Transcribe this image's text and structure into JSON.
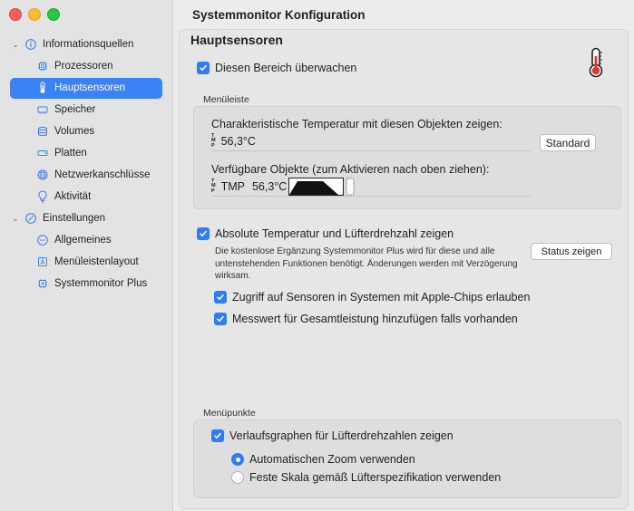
{
  "window": {
    "title": "Systemmonitor Konfiguration"
  },
  "sidebar": {
    "groups": [
      {
        "label": "Informationsquellen",
        "icon": "info-circle-icon",
        "items": [
          {
            "label": "Prozessoren",
            "icon": "cpu-chip-icon"
          },
          {
            "label": "Hauptsensoren",
            "icon": "thermometer-icon",
            "selected": true
          },
          {
            "label": "Speicher",
            "icon": "memory-icon"
          },
          {
            "label": "Volumes",
            "icon": "volume-stack-icon"
          },
          {
            "label": "Platten",
            "icon": "disk-icon"
          },
          {
            "label": "Netzwerkanschlüsse",
            "icon": "globe-icon"
          },
          {
            "label": "Aktivität",
            "icon": "lightbulb-icon"
          }
        ]
      },
      {
        "label": "Einstellungen",
        "icon": "slash-circle-icon",
        "items": [
          {
            "label": "Allgemeines",
            "icon": "ellipsis-circle-icon"
          },
          {
            "label": "Menüleistenlayout",
            "icon": "menu-layout-icon"
          },
          {
            "label": "Systemmonitor Plus",
            "icon": "cpu-plus-icon"
          }
        ]
      }
    ]
  },
  "section": {
    "title": "Hauptsensoren",
    "monitor_checkbox": "Diesen Bereich überwachen",
    "menubar_label": "Menüleiste",
    "characteristic_label": "Charakteristische Temperatur mit diesen Objekten zeigen:",
    "characteristic_value": "56,3°C",
    "standard_button": "Standard",
    "available_label": "Verfügbare Objekte (zum Aktivieren nach oben ziehen):",
    "available_tmp": "TMP",
    "available_value": "56,3°C",
    "absolute_checkbox": "Absolute Temperatur und Lüfterdrehzahl zeigen",
    "plus_note": "Die kostenlose Ergänzung Systemmonitor Plus wird für diese und alle untenstehenden Funktionen benötigt. Änderungen werden mit Verzögerung wirksam.",
    "status_button": "Status zeigen",
    "apple_chips_checkbox": "Zugriff auf Sensoren in Systemen mit Apple-Chips erlauben",
    "total_power_checkbox": "Messwert für Gesamtleistung hinzufügen falls vorhanden",
    "menu_items_label": "Menüpunkte",
    "fan_graph_checkbox": "Verlaufsgraphen für Lüfterdrehzahlen zeigen",
    "auto_zoom_radio": "Automatischen Zoom verwenden",
    "fixed_scale_radio": "Feste Skala gemäß Lüfterspezifikation verwenden"
  },
  "colors": {
    "accent": "#2f7cf6",
    "selection": "#3b82f6"
  }
}
